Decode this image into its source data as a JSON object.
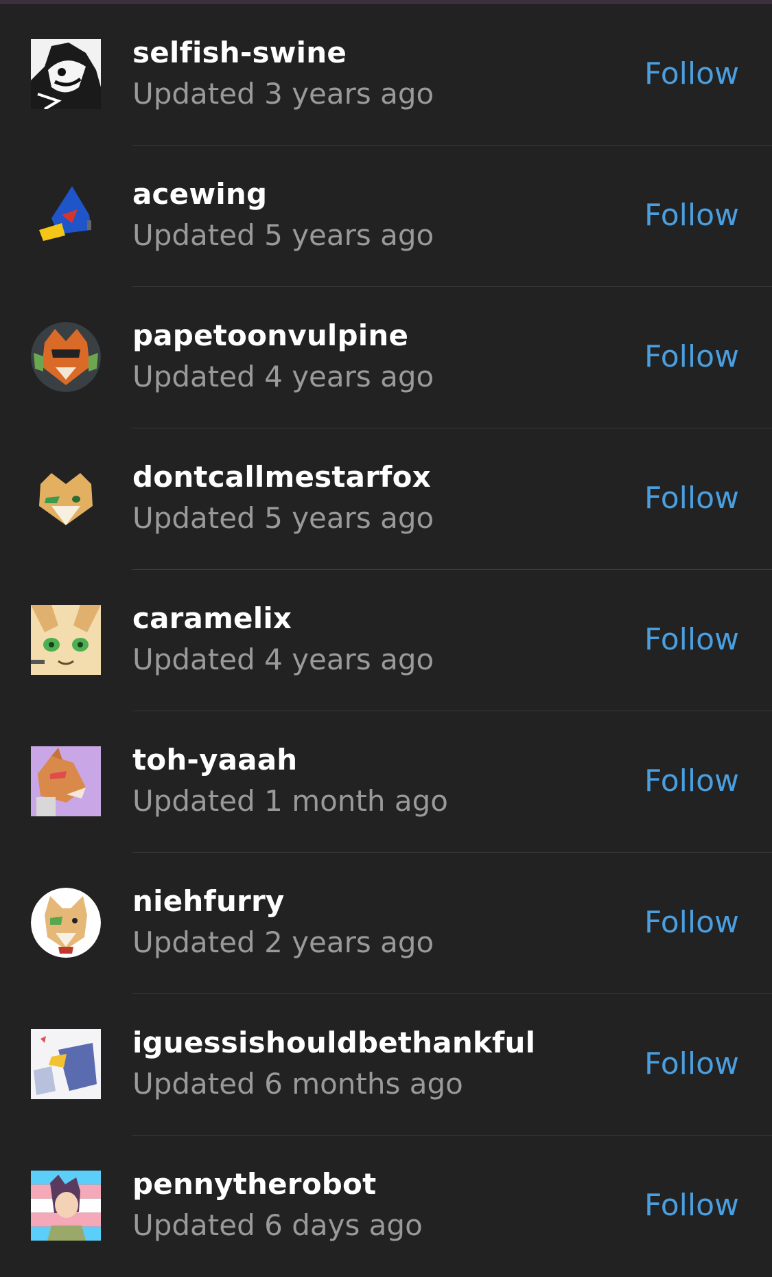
{
  "follow_color": "#4a9fe0",
  "items": [
    {
      "name": "selfish-swine",
      "updated": "Updated 3 years ago",
      "follow": "Follow",
      "avatar_icon": "cartoon-dog-bw-avatar"
    },
    {
      "name": "acewing",
      "updated": "Updated 5 years ago",
      "follow": "Follow",
      "avatar_icon": "blue-bird-helmet-avatar"
    },
    {
      "name": "papetoonvulpine",
      "updated": "Updated 4 years ago",
      "follow": "Follow",
      "avatar_icon": "fox-pilot-circle-avatar"
    },
    {
      "name": "dontcallmestarfox",
      "updated": "Updated 5 years ago",
      "follow": "Follow",
      "avatar_icon": "fox-head-avatar"
    },
    {
      "name": "caramelix",
      "updated": "Updated 4 years ago",
      "follow": "Follow",
      "avatar_icon": "fox-face-green-eyes-avatar"
    },
    {
      "name": "toh-yaaah",
      "updated": "Updated 1 month ago",
      "follow": "Follow",
      "avatar_icon": "fox-profile-purple-avatar"
    },
    {
      "name": "niehfurry",
      "updated": "Updated 2 years ago",
      "follow": "Follow",
      "avatar_icon": "fox-portrait-circle-avatar"
    },
    {
      "name": "iguessishouldbethankful",
      "updated": "Updated 6 months ago",
      "follow": "Follow",
      "avatar_icon": "bird-and-wolf-avatar"
    },
    {
      "name": "pennytherobot",
      "updated": "Updated 6 days ago",
      "follow": "Follow",
      "avatar_icon": "character-trans-flag-avatar"
    }
  ]
}
